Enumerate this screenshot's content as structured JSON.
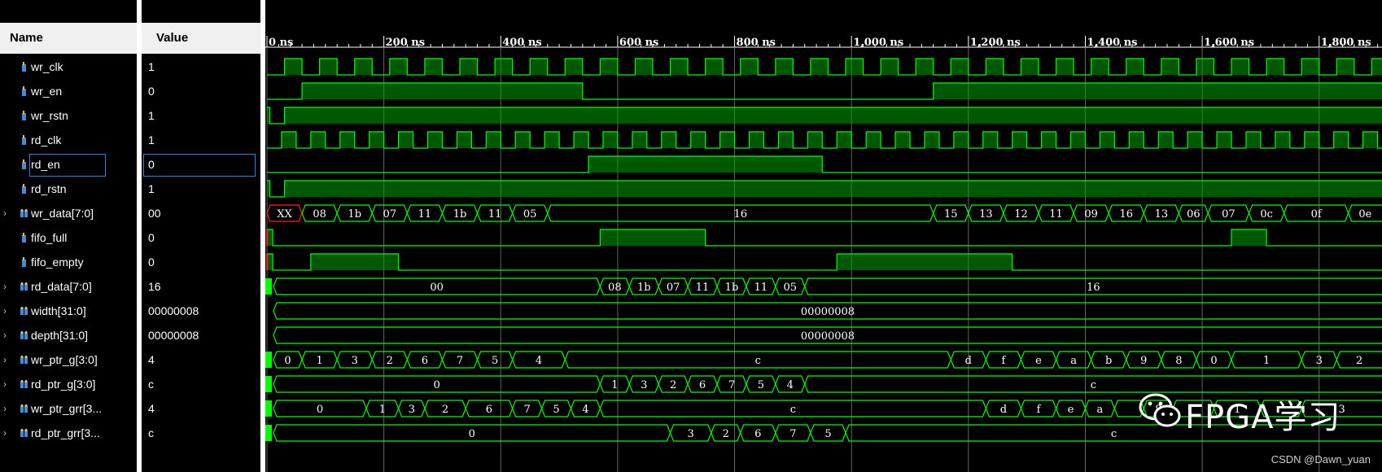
{
  "headers": {
    "name": "Name",
    "value": "Value"
  },
  "signals": [
    {
      "name": "wr_clk",
      "value": "1",
      "bus": false
    },
    {
      "name": "wr_en",
      "value": "0",
      "bus": false
    },
    {
      "name": "wr_rstn",
      "value": "1",
      "bus": false
    },
    {
      "name": "rd_clk",
      "value": "1",
      "bus": false
    },
    {
      "name": "rd_en",
      "value": "0",
      "bus": false
    },
    {
      "name": "rd_rstn",
      "value": "1",
      "bus": false
    },
    {
      "name": "wr_data[7:0]",
      "value": "00",
      "bus": true
    },
    {
      "name": "fifo_full",
      "value": "0",
      "bus": false
    },
    {
      "name": "fifo_empty",
      "value": "0",
      "bus": false
    },
    {
      "name": "rd_data[7:0]",
      "value": "16",
      "bus": true
    },
    {
      "name": "width[31:0]",
      "value": "00000008",
      "bus": true
    },
    {
      "name": "depth[31:0]",
      "value": "00000008",
      "bus": true
    },
    {
      "name": "wr_ptr_g[3:0]",
      "value": "4",
      "bus": true
    },
    {
      "name": "rd_ptr_g[3:0]",
      "value": "c",
      "bus": true
    },
    {
      "name": "wr_ptr_grr[3...",
      "value": "4",
      "bus": true
    },
    {
      "name": "rd_ptr_grr[3...",
      "value": "c",
      "bus": true
    }
  ],
  "selected_signal": "rd_en",
  "timeline": {
    "ticks": [
      "0 ns",
      "200 ns",
      "400 ns",
      "600 ns",
      "800 ns",
      "1,000 ns",
      "1,200 ns",
      "1,400 ns",
      "1,600 ns",
      "1,800 ns"
    ],
    "ns_per_major": 200
  },
  "waveforms": {
    "wr_clk": {
      "type": "clock",
      "period_ns": 60,
      "start_ns": 0
    },
    "rd_clk": {
      "type": "clock",
      "period_ns": 50,
      "start_ns": 0
    },
    "wr_en": {
      "type": "bit",
      "edges": [
        [
          0,
          0
        ],
        [
          60,
          1
        ],
        [
          540,
          0
        ],
        [
          1140,
          1
        ]
      ]
    },
    "wr_rstn": {
      "type": "bit",
      "edges": [
        [
          0,
          1
        ],
        [
          5,
          0
        ],
        [
          30,
          1
        ]
      ]
    },
    "rd_en": {
      "type": "bit",
      "edges": [
        [
          0,
          0
        ],
        [
          550,
          1
        ],
        [
          950,
          0
        ]
      ]
    },
    "rd_rstn": {
      "type": "bit",
      "edges": [
        [
          0,
          1
        ],
        [
          5,
          0
        ],
        [
          30,
          1
        ]
      ]
    },
    "fifo_full": {
      "type": "bit",
      "edges": [
        [
          0,
          1
        ],
        [
          10,
          0
        ],
        [
          570,
          1
        ],
        [
          750,
          0
        ],
        [
          1650,
          1
        ],
        [
          1710,
          0
        ]
      ]
    },
    "fifo_empty": {
      "type": "bit",
      "edges": [
        [
          0,
          1
        ],
        [
          10,
          0
        ],
        [
          75,
          1
        ],
        [
          225,
          0
        ],
        [
          975,
          1
        ],
        [
          1275,
          0
        ]
      ]
    },
    "wr_data[7:0]": {
      "type": "bus",
      "segs": [
        [
          0,
          "XX"
        ],
        [
          60,
          "08"
        ],
        [
          120,
          "1b"
        ],
        [
          180,
          "07"
        ],
        [
          240,
          "11"
        ],
        [
          300,
          "1b"
        ],
        [
          360,
          "11"
        ],
        [
          420,
          "05"
        ],
        [
          480,
          "16"
        ],
        [
          1140,
          "15"
        ],
        [
          1200,
          "13"
        ],
        [
          1260,
          "12"
        ],
        [
          1320,
          "11"
        ],
        [
          1380,
          "09"
        ],
        [
          1440,
          "16"
        ],
        [
          1500,
          "13"
        ],
        [
          1560,
          "06"
        ],
        [
          1610,
          "07"
        ],
        [
          1680,
          "0c"
        ],
        [
          1740,
          "0f"
        ],
        [
          1850,
          "0e"
        ]
      ]
    },
    "rd_data[7:0]": {
      "type": "bus",
      "segs": [
        [
          0,
          "00"
        ],
        [
          570,
          "08"
        ],
        [
          620,
          "1b"
        ],
        [
          670,
          "07"
        ],
        [
          720,
          "11"
        ],
        [
          770,
          "1b"
        ],
        [
          820,
          "11"
        ],
        [
          870,
          "05"
        ],
        [
          920,
          "16"
        ]
      ]
    },
    "width[31:0]": {
      "type": "bus",
      "segs": [
        [
          0,
          "00000008"
        ]
      ]
    },
    "depth[31:0]": {
      "type": "bus",
      "segs": [
        [
          0,
          "00000008"
        ]
      ]
    },
    "wr_ptr_g[3:0]": {
      "type": "bus",
      "segs": [
        [
          0,
          "0"
        ],
        [
          60,
          "1"
        ],
        [
          120,
          "3"
        ],
        [
          180,
          "2"
        ],
        [
          240,
          "6"
        ],
        [
          300,
          "7"
        ],
        [
          360,
          "5"
        ],
        [
          420,
          "4"
        ],
        [
          510,
          "c"
        ],
        [
          1170,
          "d"
        ],
        [
          1230,
          "f"
        ],
        [
          1290,
          "e"
        ],
        [
          1350,
          "a"
        ],
        [
          1410,
          "b"
        ],
        [
          1470,
          "9"
        ],
        [
          1530,
          "8"
        ],
        [
          1590,
          "0"
        ],
        [
          1650,
          "1"
        ],
        [
          1770,
          "3"
        ],
        [
          1830,
          "2"
        ]
      ]
    },
    "rd_ptr_g[3:0]": {
      "type": "bus",
      "segs": [
        [
          0,
          "0"
        ],
        [
          570,
          "1"
        ],
        [
          620,
          "3"
        ],
        [
          670,
          "2"
        ],
        [
          720,
          "6"
        ],
        [
          770,
          "7"
        ],
        [
          820,
          "5"
        ],
        [
          870,
          "4"
        ],
        [
          920,
          "c"
        ]
      ]
    },
    "wr_ptr_grr[3...": {
      "type": "bus",
      "segs": [
        [
          0,
          "0"
        ],
        [
          170,
          "1"
        ],
        [
          225,
          "3"
        ],
        [
          270,
          "2"
        ],
        [
          340,
          "6"
        ],
        [
          420,
          "7"
        ],
        [
          470,
          "5"
        ],
        [
          520,
          "4"
        ],
        [
          570,
          "c"
        ],
        [
          1230,
          "d"
        ],
        [
          1290,
          "f"
        ],
        [
          1350,
          "e"
        ],
        [
          1400,
          "a"
        ],
        [
          1450,
          ""
        ],
        [
          1500,
          "8"
        ],
        [
          1550,
          ""
        ],
        [
          1620,
          "1"
        ],
        [
          1700,
          ""
        ],
        [
          1770,
          "3"
        ]
      ]
    },
    "rd_ptr_grr[3...": {
      "type": "bus",
      "segs": [
        [
          0,
          "0"
        ],
        [
          690,
          "3"
        ],
        [
          760,
          "2"
        ],
        [
          810,
          "6"
        ],
        [
          870,
          "7"
        ],
        [
          930,
          "5"
        ],
        [
          990,
          "c"
        ]
      ]
    }
  },
  "watermark": {
    "text": "FPGA学习",
    "credit": "CSDN @Dawn_yuan",
    "icon": "wechat-icon"
  },
  "colors": {
    "wave": "#00ff00",
    "wave_fill": "#00a000",
    "xx": "#ff2020",
    "grid": "#666666",
    "selection": "#3d7fd6"
  }
}
